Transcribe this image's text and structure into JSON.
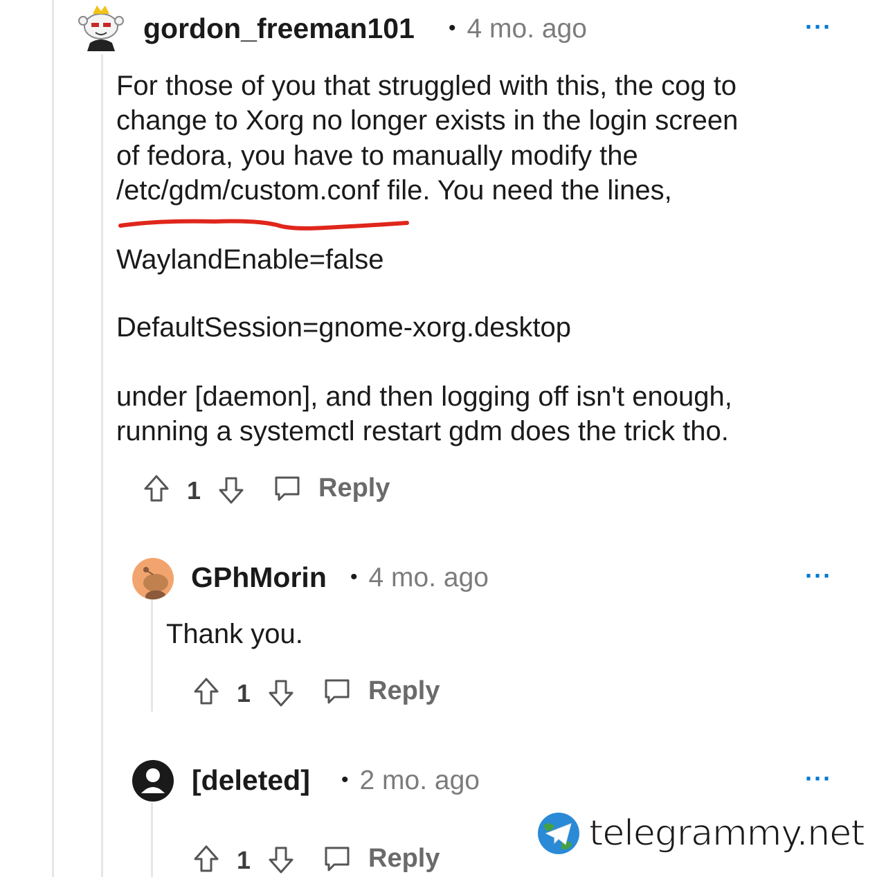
{
  "comments": [
    {
      "username": "gordon_freeman101",
      "age": "4 mo. ago",
      "more": "···",
      "body": [
        "For those of you that struggled with this, the cog to",
        "change to Xorg no longer exists in the login screen",
        "of fedora, you have to manually modify the",
        "/etc/gdm/custom.conf file. You need the lines,",
        "WaylandEnable=false",
        "DefaultSession=gnome-xorg.desktop",
        "under [daemon], and then logging off isn't enough,",
        "running a systemctl restart gdm does the trick tho."
      ],
      "votes": "1",
      "reply_label": "Reply"
    },
    {
      "username": "GPhMorin",
      "age": "4 mo. ago",
      "more": "···",
      "body": [
        "Thank you."
      ],
      "votes": "1",
      "reply_label": "Reply"
    },
    {
      "username": "[deleted]",
      "age": "2 mo. ago",
      "more": "···",
      "votes": "1",
      "reply_label": "Reply"
    }
  ],
  "icons": {
    "upvote": "arrow-up-icon",
    "downvote": "arrow-down-icon",
    "reply": "speech-bubble-icon"
  },
  "colors": {
    "accent": "#0079d3",
    "annotation_underline": "#e0261b",
    "thread_line": "#e4e6e8"
  },
  "watermark": {
    "text": "telegrammy.net"
  }
}
